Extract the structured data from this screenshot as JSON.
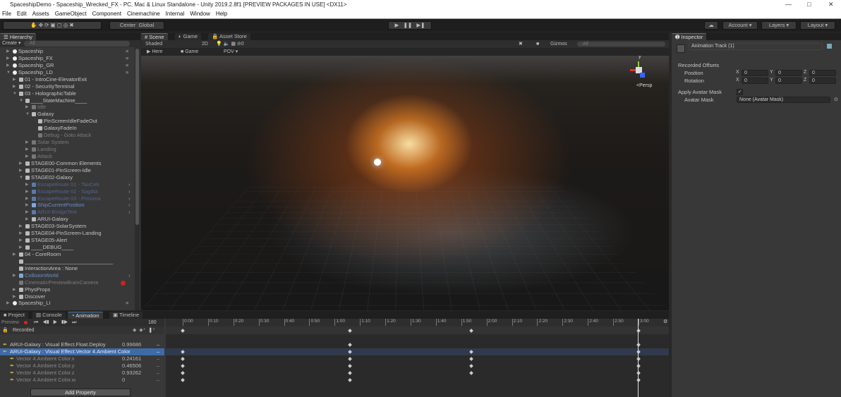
{
  "window": {
    "title": "SpaceshipDemo - Spaceship_Wrecked_FX - PC, Mac & Linux Standalone - Unity 2019.2.8f1 [PREVIEW PACKAGES IN USE] <DX11>"
  },
  "menu": [
    "File",
    "Edit",
    "Assets",
    "GameObject",
    "Component",
    "Cinemachine",
    "Internal",
    "Window",
    "Help"
  ],
  "toolbar": {
    "pivot": "Center",
    "space": "Global",
    "account": "Account",
    "layers": "Layers",
    "layout": "Layout"
  },
  "hierarchy": {
    "tab": "Hierarchy",
    "create": "Create",
    "search_placeholder": "All",
    "items": [
      {
        "label": "Spaceship",
        "depth": 0,
        "state": "root",
        "arrow": "right"
      },
      {
        "label": "Spaceship_FX",
        "depth": 0,
        "state": "root",
        "arrow": "right"
      },
      {
        "label": "Spaceship_GR",
        "depth": 0,
        "state": "root",
        "arrow": "right"
      },
      {
        "label": "Spaceship_LD",
        "depth": 0,
        "state": "root",
        "arrow": "down"
      },
      {
        "label": "01 - IntroCine-ElevatorExit",
        "depth": 1,
        "state": "",
        "arrow": "right"
      },
      {
        "label": "02 - SecurityTerminal",
        "depth": 1,
        "state": "",
        "arrow": "right"
      },
      {
        "label": "03 - HolographicTable",
        "depth": 1,
        "state": "",
        "arrow": "down"
      },
      {
        "label": "____StateMachine____",
        "depth": 2,
        "state": "",
        "arrow": "down"
      },
      {
        "label": "Idle",
        "depth": 3,
        "state": "dis",
        "arrow": "right"
      },
      {
        "label": "Galaxy",
        "depth": 3,
        "state": "",
        "arrow": "down"
      },
      {
        "label": "PinScreenIdleFadeOut",
        "depth": 4,
        "state": "",
        "arrow": ""
      },
      {
        "label": "GalaxyFadeIn",
        "depth": 4,
        "state": "",
        "arrow": ""
      },
      {
        "label": "Debug - Goto Attack",
        "depth": 4,
        "state": "dis",
        "arrow": ""
      },
      {
        "label": "Solar System",
        "depth": 3,
        "state": "dis",
        "arrow": "right"
      },
      {
        "label": "Landing",
        "depth": 3,
        "state": "dis",
        "arrow": "right"
      },
      {
        "label": "Attack",
        "depth": 3,
        "state": "dis",
        "arrow": "right"
      },
      {
        "label": "STAGE00-Common Elements",
        "depth": 2,
        "state": "",
        "arrow": "right"
      },
      {
        "label": "STAGE01-PinScreen-Idle",
        "depth": 2,
        "state": "",
        "arrow": "right"
      },
      {
        "label": "STAGE02-Galaxy",
        "depth": 2,
        "state": "",
        "arrow": "down"
      },
      {
        "label": "EscapeRoute 01 - TauCeti",
        "depth": 3,
        "state": "bluedim",
        "arrow": "right",
        "more": true
      },
      {
        "label": "EscapeRoute 02 - Sagitta",
        "depth": 3,
        "state": "bluedim",
        "arrow": "right",
        "more": true
      },
      {
        "label": "EscapeRoute 03 - Proxima",
        "depth": 3,
        "state": "bluedim",
        "arrow": "right",
        "more": true
      },
      {
        "label": "ShipCurrentPosition",
        "depth": 3,
        "state": "blue",
        "arrow": "right",
        "more": true
      },
      {
        "label": "ARUI-BridgeText",
        "depth": 3,
        "state": "bluedim",
        "arrow": "right",
        "more": true
      },
      {
        "label": "ARUI-Galaxy",
        "depth": 3,
        "state": "",
        "arrow": "right"
      },
      {
        "label": "STAGE03-SolarSystem",
        "depth": 2,
        "state": "",
        "arrow": "right"
      },
      {
        "label": "STAGE04-PinScreen-Landing",
        "depth": 2,
        "state": "",
        "arrow": "right"
      },
      {
        "label": "STAGE05-Alert",
        "depth": 2,
        "state": "",
        "arrow": "right"
      },
      {
        "label": "____DEBUG____",
        "depth": 2,
        "state": "",
        "arrow": "right"
      },
      {
        "label": "04 - CoreRoom",
        "depth": 1,
        "state": "",
        "arrow": "right"
      },
      {
        "label": "______________________________",
        "depth": 1,
        "state": "",
        "arrow": ""
      },
      {
        "label": "InteractionArea : None",
        "depth": 1,
        "state": "",
        "arrow": ""
      },
      {
        "label": "CollisionWorld",
        "depth": 1,
        "state": "blue",
        "arrow": "right",
        "more": true
      },
      {
        "label": "CinematicPreviewBrainCamera",
        "depth": 1,
        "state": "dis",
        "arrow": "",
        "badge": true
      },
      {
        "label": "PhysProps",
        "depth": 1,
        "state": "",
        "arrow": "right"
      },
      {
        "label": "Discover",
        "depth": 1,
        "state": "",
        "arrow": "right"
      },
      {
        "label": "Spaceship_LI",
        "depth": 0,
        "state": "root",
        "arrow": "right"
      }
    ]
  },
  "scene": {
    "tabs": [
      "Scene",
      "Game",
      "Asset Store"
    ],
    "shading": "Shaded",
    "mode2d": "2D",
    "fx_count": "0",
    "gizmos": "Gizmos",
    "search_placeholder": "All",
    "here": "Here",
    "game": "Game",
    "pov": "POV",
    "persp": "Persp",
    "axis_y": "y",
    "axis_x": "x"
  },
  "inspector": {
    "tab": "Inspector",
    "object_name": "Animation Track (1)",
    "recorded_offsets": "Recorded Offsets",
    "position": {
      "label": "Position",
      "x": "0",
      "y": "0",
      "z": "0"
    },
    "rotation": {
      "label": "Rotation",
      "x": "0",
      "y": "0",
      "z": "0"
    },
    "apply_avatar_mask": {
      "label": "Apply Avatar Mask",
      "checked": true
    },
    "avatar_mask": {
      "label": "Avatar Mask",
      "value": "None (Avatar Mask)"
    },
    "ax": "X",
    "ay": "Y",
    "az": "Z"
  },
  "bottom": {
    "tabs": [
      "Project",
      "Console",
      "Animation",
      "Timeline"
    ],
    "active_tab": "Animation",
    "preview": "Preview",
    "frame": "180",
    "recorded": "Recorded",
    "add_property": "Add Property",
    "properties": [
      {
        "label": "ARUI-Galaxy : Visual Effect.Float.Deploy",
        "value": "0.99686",
        "indent": 0,
        "selected": false,
        "keys": [
          1.1,
          3.0
        ]
      },
      {
        "label": "ARUI-Galaxy : Visual Effect.Vector 4.Ambient Color",
        "value": "",
        "indent": 0,
        "selected": true,
        "keys": [
          0,
          1.1,
          1.9,
          3.0
        ]
      },
      {
        "label": "Vector 4.Ambient Color.x",
        "value": "0.24161",
        "indent": 1,
        "selected": false,
        "keys": [
          0,
          1.1,
          1.9,
          3.0
        ]
      },
      {
        "label": "Vector 4.Ambient Color.y",
        "value": "0.46506",
        "indent": 1,
        "selected": false,
        "keys": [
          0,
          1.1,
          1.9,
          3.0
        ]
      },
      {
        "label": "Vector 4.Ambient Color.z",
        "value": "0.93262",
        "indent": 1,
        "selected": false,
        "keys": [
          0,
          1.1,
          1.9,
          3.0
        ]
      },
      {
        "label": "Vector 4.Ambient Color.w",
        "value": "0",
        "indent": 1,
        "selected": false,
        "keys": [
          0,
          1.1,
          3.0
        ]
      }
    ],
    "summary_keys": [
      0,
      1.1,
      1.9,
      3.0
    ],
    "ticks": [
      "0:00",
      "0:10",
      "0:20",
      "0:30",
      "0:40",
      "0:50",
      "1:00",
      "1:10",
      "1:20",
      "1:30",
      "1:40",
      "1:50",
      "2:00",
      "2:10",
      "2:20",
      "2:30",
      "2:40",
      "2:50",
      "3:00"
    ],
    "playhead_min": 3.0
  }
}
